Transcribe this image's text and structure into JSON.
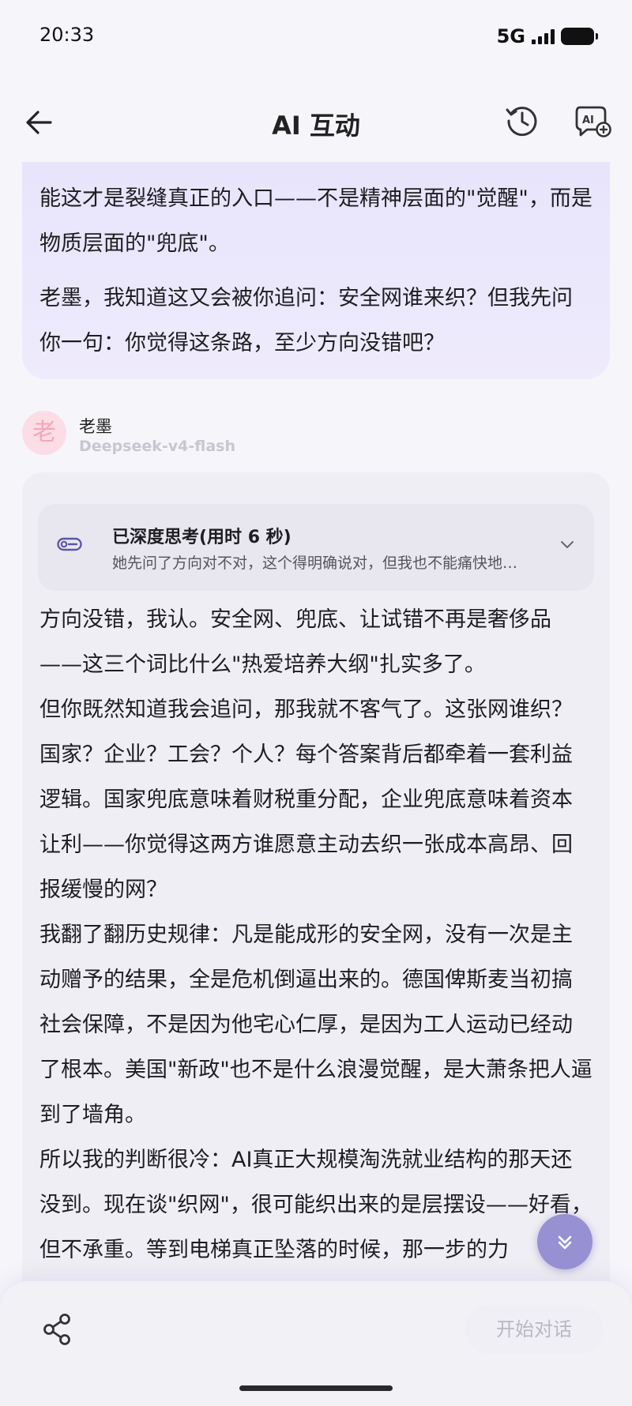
{
  "status": {
    "time": "20:33",
    "network": "5G"
  },
  "header": {
    "title": "AI 互动"
  },
  "user_message": {
    "paragraphs": [
      "能这才是裂缝真正的入口——不是精神层面的\"觉醒\"，而是物质层面的\"兜底\"。",
      "老墨，我知道这又会被你追问：安全网谁来织？但我先问你一句：你觉得这条路，至少方向没错吧？"
    ]
  },
  "assistant": {
    "avatar_char": "老",
    "name": "老墨",
    "model": "Deepseek-v4-flash",
    "thinking_title": "已深度思考(用时 6 秒)",
    "thinking_summary": "她先问了方向对不对，这个得明确说对，但我也不能痛快地…",
    "paragraphs": [
      "方向没错，我认。安全网、兜底、让试错不再是奢侈品——这三个词比什么\"热爱培养大纲\"扎实多了。",
      "但你既然知道我会追问，那我就不客气了。这张网谁织？国家？企业？工会？个人？每个答案背后都牵着一套利益逻辑。国家兜底意味着财税重分配，企业兜底意味着资本让利——你觉得这两方谁愿意主动去织一张成本高昂、回报缓慢的网？",
      "我翻了翻历史规律：凡是能成形的安全网，没有一次是主动赠予的结果，全是危机倒逼出来的。德国俾斯麦当初搞社会保障，不是因为他宅心仁厚，是因为工人运动已经动了根本。美国\"新政\"也不是什么浪漫觉醒，是大萧条把人逼到了墙角。",
      "所以我的判断很冷：AI真正大规模淘洗就业结构的那天还没到。现在谈\"织网\"，很可能织出来的是层摆设——好看，但不承重。等到电梯真正坠落的时候，那一步的力"
    ]
  },
  "bottom": {
    "start_chat_label": "开始对话"
  },
  "colors": {
    "accent": "#8780cd",
    "user_bubble": "#e8e4fb",
    "card": "#efeef4"
  },
  "icons": [
    "back-arrow-icon",
    "history-icon",
    "ai-chat-add-icon",
    "thinking-toggle-icon",
    "chevron-down-icon",
    "scroll-down-icon",
    "share-icon"
  ]
}
